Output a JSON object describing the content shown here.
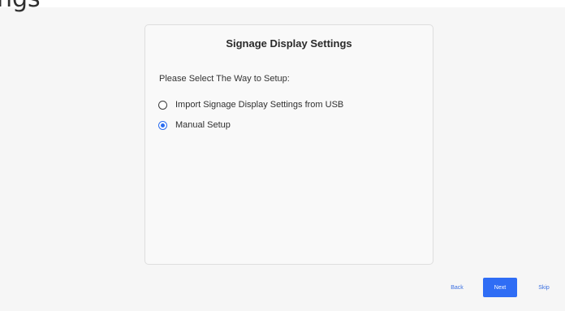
{
  "app": {
    "background_title_fragment": "ngs"
  },
  "card": {
    "title": "Signage Display Settings",
    "prompt": "Please Select The Way to Setup:",
    "options": [
      {
        "label": "Import Signage Display Settings from USB",
        "selected": false
      },
      {
        "label": "Manual Setup",
        "selected": true
      }
    ]
  },
  "nav": {
    "back_label": "Back",
    "next_label": "Next",
    "skip_label": "Skip"
  },
  "colors": {
    "accent": "#2f6df5",
    "link": "#3b6fe0",
    "background": "#f6f6f6",
    "card": "#f9f9f9"
  }
}
